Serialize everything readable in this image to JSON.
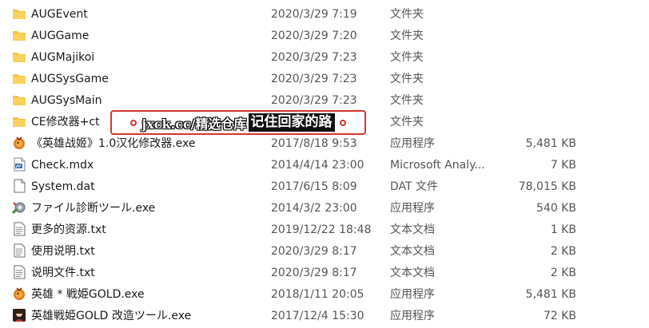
{
  "files": [
    {
      "icon": "folder-icon",
      "name": "AUGEvent",
      "date": "2020/3/29 7:19",
      "type": "文件夹",
      "size": ""
    },
    {
      "icon": "folder-icon",
      "name": "AUGGame",
      "date": "2020/3/29 7:20",
      "type": "文件夹",
      "size": ""
    },
    {
      "icon": "folder-icon",
      "name": "AUGMajikoi",
      "date": "2020/3/29 7:23",
      "type": "文件夹",
      "size": ""
    },
    {
      "icon": "folder-icon",
      "name": "AUGSysGame",
      "date": "2020/3/29 7:23",
      "type": "文件夹",
      "size": ""
    },
    {
      "icon": "folder-icon",
      "name": "AUGSysMain",
      "date": "2020/3/29 7:23",
      "type": "文件夹",
      "size": ""
    },
    {
      "icon": "folder-icon",
      "name": "CE修改器+ct",
      "date": "",
      "type": "文件夹",
      "size": ""
    },
    {
      "icon": "trainer-app-icon",
      "name": "《英雄战姬》1.0汉化修改器.exe",
      "date": "2017/8/18 9:53",
      "type": "应用程序",
      "size": "5,481 KB"
    },
    {
      "icon": "mdx-file-icon",
      "name": "Check.mdx",
      "date": "2014/4/14 23:00",
      "type": "Microsoft Analy...",
      "size": "7 KB"
    },
    {
      "icon": "blank-file-icon",
      "name": "System.dat",
      "date": "2017/6/15 8:09",
      "type": "DAT 文件",
      "size": "78,015 KB"
    },
    {
      "icon": "diagnostic-tool-icon",
      "name": "ファイル診断ツール.exe",
      "date": "2014/3/2 23:00",
      "type": "应用程序",
      "size": "540 KB"
    },
    {
      "icon": "text-file-icon",
      "name": "更多的资源.txt",
      "date": "2019/12/22 18:48",
      "type": "文本文档",
      "size": "1 KB"
    },
    {
      "icon": "text-file-icon",
      "name": "使用说明.txt",
      "date": "2020/3/29 8:17",
      "type": "文本文档",
      "size": "2 KB"
    },
    {
      "icon": "text-file-icon",
      "name": "说明文件.txt",
      "date": "2020/3/29 8:17",
      "type": "文本文档",
      "size": "2 KB"
    },
    {
      "icon": "trainer-app-icon",
      "name": "英雄 * 戦姫GOLD.exe",
      "date": "2018/1/11 20:05",
      "type": "应用程序",
      "size": "5,481 KB"
    },
    {
      "icon": "game-app-icon",
      "name": "英雄戦姫GOLD 改造ツール.exe",
      "date": "2017/12/4 15:30",
      "type": "应用程序",
      "size": "72 KB"
    }
  ],
  "watermark": {
    "site": "jxck.cc/精选仓库",
    "slogan": "记住回家的路"
  },
  "colors": {
    "folder": "#f5c342",
    "watermark_border": "#d8342f",
    "text_primary": "#1a1a1a",
    "text_secondary": "#555555"
  }
}
